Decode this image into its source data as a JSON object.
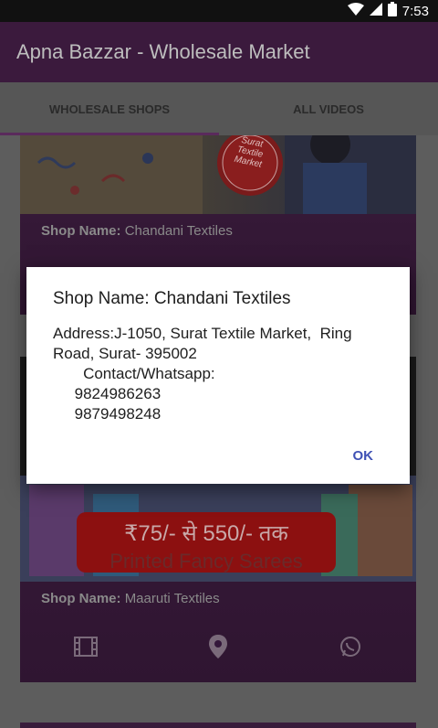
{
  "status_bar": {
    "time": "7:53"
  },
  "app_bar": {
    "title": "Apna Bazzar - Wholesale Market"
  },
  "tabs": [
    {
      "label": "WHOLESALE SHOPS"
    },
    {
      "label": "ALL VIDEOS"
    }
  ],
  "cards": [
    {
      "image_stamp": [
        "Surat",
        "Textile",
        "Market"
      ],
      "label_prefix": "Shop Name:",
      "label_value": "Chandani Textiles"
    },
    {
      "banner_price": "₹75/- से 550/- तक",
      "banner_sub": "Printed Fancy Sarees",
      "label_prefix": "Shop Name:",
      "label_value": "Maaruti Textiles"
    }
  ],
  "dialog": {
    "title": "Shop Name: Chandani Textiles",
    "body": "Address:J-1050, Surat Textile Market,  Ring Road, Surat- 395002\n       Contact/Whatsapp:\n     9824986263\n     9879498248",
    "ok_label": "OK"
  },
  "colors": {
    "app_bar": "#3b1a3d",
    "accent": "#3f51b5",
    "card": "#3a1c3c"
  }
}
